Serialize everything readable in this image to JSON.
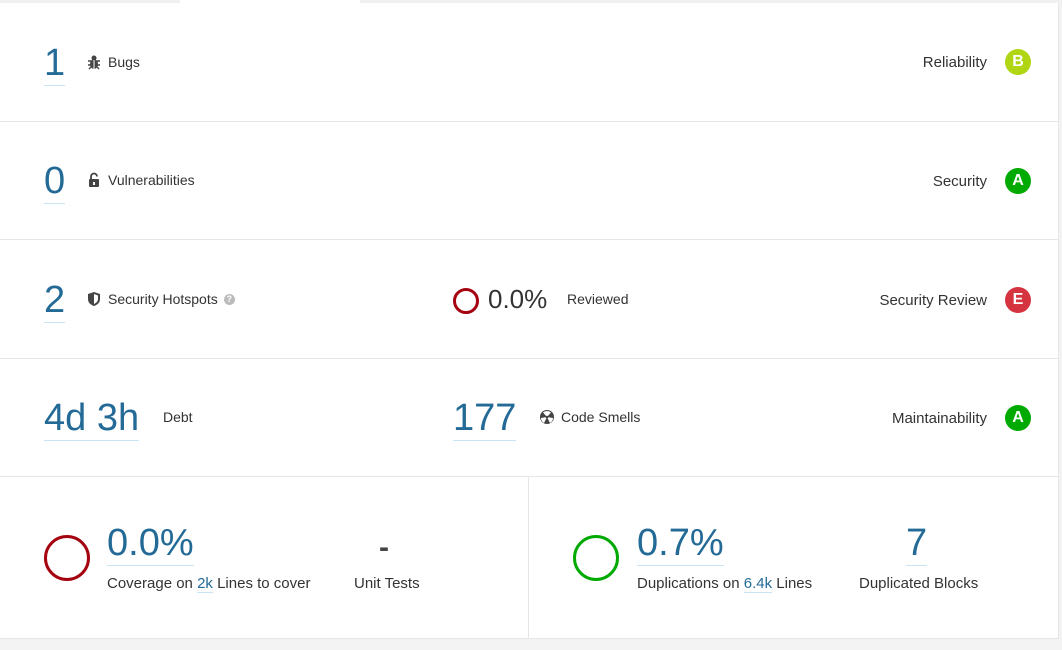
{
  "reliability": {
    "value": "1",
    "label": "Bugs",
    "icon": "bug-icon",
    "rating_label": "Reliability",
    "rating": "B",
    "rating_color": "#b0d513"
  },
  "security": {
    "value": "0",
    "label": "Vulnerabilities",
    "icon": "lock-open-icon",
    "rating_label": "Security",
    "rating": "A",
    "rating_color": "#00aa00"
  },
  "hotspots": {
    "value": "2",
    "label": "Security Hotspots",
    "help": "?",
    "reviewed_value": "0.0%",
    "reviewed_label": "Reviewed",
    "rating_label": "Security Review",
    "rating": "E",
    "rating_color": "#d4333f",
    "ring_color": "#a4030f"
  },
  "maintainability": {
    "debt_value": "4d 3h",
    "debt_label": "Debt",
    "smells_value": "177",
    "smells_label": "Code Smells",
    "rating_label": "Maintainability",
    "rating": "A",
    "rating_color": "#00aa00"
  },
  "coverage": {
    "value": "0.0%",
    "prefix": "Coverage on",
    "lines": "2k",
    "suffix": "Lines to cover",
    "unit_tests_value": "-",
    "unit_tests_label": "Unit Tests",
    "ring_color": "#a4030f"
  },
  "duplications": {
    "value": "0.7%",
    "prefix": "Duplications on",
    "lines": "6.4k",
    "suffix": "Lines",
    "blocks_value": "7",
    "blocks_label": "Duplicated Blocks",
    "ring_color": "#00aa00"
  }
}
